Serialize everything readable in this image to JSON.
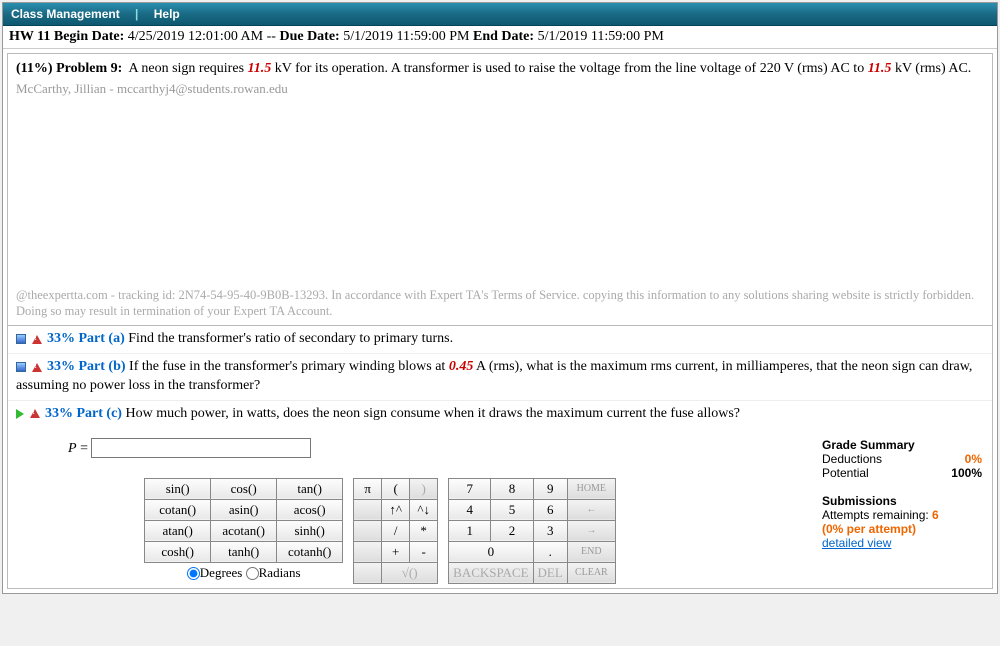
{
  "menu": {
    "class_management": "Class Management",
    "help": "Help"
  },
  "hw": {
    "title": "HW 11",
    "begin_label": "Begin Date:",
    "begin": "4/25/2019 12:01:00 AM",
    "sep": "--",
    "due_label": "Due Date:",
    "due": "5/1/2019 11:59:00 PM",
    "end_label": "End Date:",
    "end": "5/1/2019 11:59:00 PM"
  },
  "problem": {
    "weight": "(11%)",
    "label": "Problem 9:",
    "text1": "A neon sign requires ",
    "val1": "11.5",
    "text2": " kV for its operation. A transformer is used to raise the voltage from the line voltage of 220 V (rms) AC to ",
    "val2": "11.5",
    "text3": " kV (rms) AC."
  },
  "student": "McCarthy, Jillian - mccarthyj4@students.rowan.edu",
  "tracking": "@theexpertta.com - tracking id: 2N74-54-95-40-9B0B-13293. In accordance with Expert TA's Terms of Service. copying this information to any solutions sharing website is strictly forbidden. Doing so may result in termination of your Expert TA Account.",
  "parts": {
    "a": {
      "pct": "33%",
      "label": "Part (a)",
      "text": "Find the transformer's ratio of secondary to primary turns."
    },
    "b": {
      "pct": "33%",
      "label": "Part (b)",
      "text1": "If the fuse in the transformer's primary winding blows at ",
      "val": "0.45",
      "text2": " A (rms), what is the maximum rms current, in milliamperes, that the neon sign can draw, assuming no power loss in the transformer?"
    },
    "c": {
      "pct": "33%",
      "label": "Part (c)",
      "text": "How much power, in watts, does the neon sign consume when it draws the maximum current the fuse allows?"
    }
  },
  "answer": {
    "var": "P",
    "eq": " = ",
    "value": ""
  },
  "grade": {
    "title": "Grade Summary",
    "ded_label": "Deductions",
    "ded": "0%",
    "pot_label": "Potential",
    "pot": "100%",
    "sub_title": "Submissions",
    "attempts_label": "Attempts remaining: ",
    "attempts": "6",
    "per": "(0% per attempt)",
    "detailed": "detailed view"
  },
  "fnkeys": [
    [
      "sin()",
      "cos()",
      "tan()"
    ],
    [
      "cotan()",
      "asin()",
      "acos()"
    ],
    [
      "atan()",
      "acotan()",
      "sinh()"
    ],
    [
      "cosh()",
      "tanh()",
      "cotanh()"
    ]
  ],
  "symkeys": [
    [
      "π",
      "(",
      ")"
    ],
    [
      "",
      "↑^",
      "^↓"
    ],
    [
      "",
      "/",
      "*"
    ],
    [
      "",
      "+",
      "-"
    ],
    [
      "",
      "√()",
      ""
    ]
  ],
  "numkeys": [
    [
      "7",
      "8",
      "9"
    ],
    [
      "4",
      "5",
      "6"
    ],
    [
      "1",
      "2",
      "3"
    ],
    [
      "0",
      "",
      "."
    ]
  ],
  "navkeys": [
    "HOME",
    "←",
    "→",
    "END",
    "CLEAR"
  ],
  "backspace": "BACKSPACE",
  "del": "DEL",
  "modes": {
    "deg": "Degrees",
    "rad": "Radians"
  }
}
